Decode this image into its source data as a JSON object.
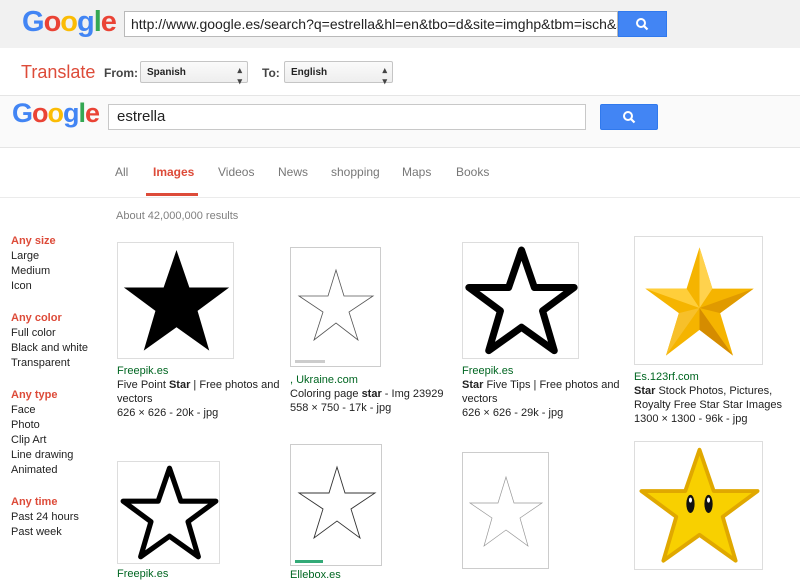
{
  "translate_bar": {
    "logo": [
      "G",
      "o",
      "o",
      "g",
      "l",
      "e"
    ],
    "url": "http://www.google.es/search?q=estrella&hl=en&tbo=d&site=imghp&tbm=isch&source=hp",
    "title": "Translate",
    "from_label": "From:",
    "from_value": "Spanish",
    "to_label": "To:",
    "to_value": "English"
  },
  "search": {
    "logo": [
      "G",
      "o",
      "o",
      "g",
      "l",
      "e"
    ],
    "query": "estrella",
    "button_icon": "search-icon"
  },
  "tabs": [
    "All",
    "Images",
    "Videos",
    "News",
    "shopping",
    "Maps",
    "Books"
  ],
  "active_tab": "Images",
  "result_stats": "About 42,000,000 results",
  "sidebar": [
    {
      "head": "Any size",
      "items": [
        "Large",
        "Medium",
        "Icon"
      ]
    },
    {
      "head": "Any color",
      "items": [
        "Full color",
        "Black and white",
        "Transparent"
      ]
    },
    {
      "head": "Any type",
      "items": [
        "Face",
        "Photo",
        "Clip Art",
        "Line drawing",
        "Animated"
      ]
    },
    {
      "head": "Any time",
      "items": [
        "Past 24 hours",
        "Past week"
      ]
    }
  ],
  "results": [
    {
      "source": "Freepik.es",
      "title_before": "Five Point ",
      "title_bold": "Star",
      "title_after": " | Free photos and vectors",
      "meta": "626 × 626 - 20k - jpg",
      "icon": "filled-star-image"
    },
    {
      "source": ", Ukraine.com",
      "title_before": "Coloring page ",
      "title_bold": "star",
      "title_after": " - Img 23929",
      "meta": "558 × 750 - 17k - jpg",
      "icon": "outline-star-coloring-page-image"
    },
    {
      "source": "Freepik.es",
      "title_before": "",
      "title_bold": "Star",
      "title_after": " Five Tips | Free photos and vectors",
      "meta": "626 × 626 - 29k - jpg",
      "icon": "rounded-outline-star-image"
    },
    {
      "source": "Es.123rf.com",
      "title_before": "",
      "title_bold": "Star",
      "title_after": " Stock Photos, Pictures, Royalty Free Star Star Images",
      "meta": "1300 × 1300 - 96k - jpg",
      "icon": "gold-3d-star-image"
    },
    {
      "source": "Freepik.es",
      "title_before": "",
      "title_bold": "",
      "title_after": "",
      "meta": "",
      "icon": "thick-outline-star-image"
    },
    {
      "source": "Ellebox.es",
      "title_before": "",
      "title_bold": "",
      "title_after": "",
      "meta": "",
      "icon": "thin-outline-star-image"
    },
    {
      "source": "",
      "title_before": "",
      "title_bold": "",
      "title_after": "",
      "meta": "",
      "icon": "faint-outline-star-image"
    },
    {
      "source": "",
      "title_before": "",
      "title_bold": "",
      "title_after": "",
      "meta": "",
      "icon": "mario-star-image"
    }
  ],
  "colors": {
    "google_blue": "#4285f4",
    "google_red": "#ea4335",
    "google_yellow": "#fbbc05",
    "google_green": "#34a853",
    "accent_red": "#dd4b39",
    "source_green": "#006621"
  }
}
